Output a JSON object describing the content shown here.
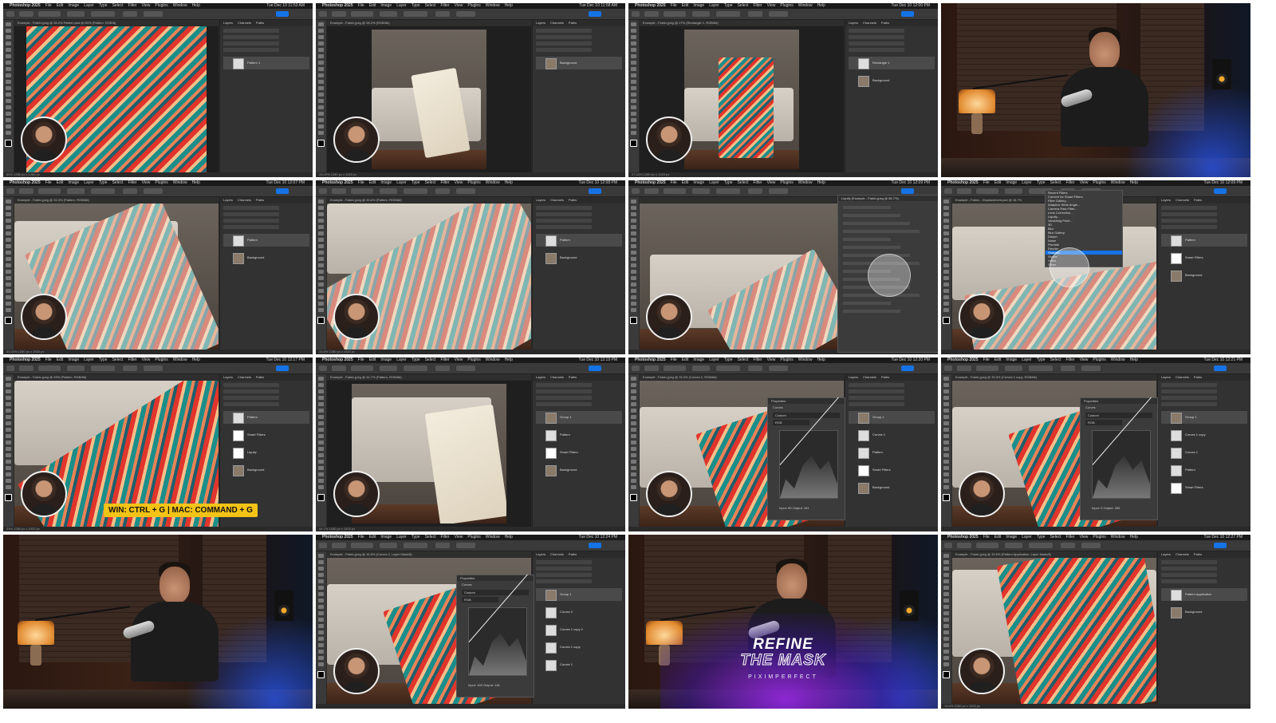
{
  "menubar": {
    "app": "Photoshop 2025",
    "items": [
      "File",
      "Edit",
      "Image",
      "Layer",
      "Type",
      "Select",
      "Filter",
      "View",
      "Plugins",
      "Window",
      "Help"
    ],
    "title": "Adobe Photoshop 2025"
  },
  "panel_tabs": [
    "Layers",
    "Channels",
    "Paths"
  ],
  "tiles": [
    {
      "kind": "ps",
      "clock": "Tue Dec 10 11:53 AM",
      "tab": "Example - Fabric.jpeg @ 28.2%   Pattern.psd @ 50% (Pattern, RGB/8)",
      "layers": [
        "Pattern 1"
      ],
      "status": "50%   1280 px x 1280 px"
    },
    {
      "kind": "ps",
      "clock": "Tue Dec 10 11:58 AM",
      "tab": "Example - Fabric.jpeg @ 28.2% (RGB/8#)",
      "layers": [
        "Background"
      ],
      "status": "28.09%   1280 px x 1920 px"
    },
    {
      "kind": "ps",
      "clock": "Tue Dec 10 12:00 PM",
      "tab": "Example - Fabric.jpeg @ 27% (Rectangle 1, RGB/8#)",
      "layers": [
        "Rectangle 1",
        "Background"
      ],
      "status": "27.04%   1280 px x 1920 px"
    },
    {
      "kind": "studio"
    },
    {
      "kind": "ps",
      "clock": "Tue Dec 10 12:07 PM",
      "tab": "Example - Fabric.jpeg @ 33.3% (Pattern, RGB/8#)",
      "layers": [
        "Pattern",
        "Background"
      ],
      "status": "33.33%   1280 px x 1920 px"
    },
    {
      "kind": "ps",
      "clock": "Tue Dec 10 12:08 PM",
      "tab": "Example - Fabric.jpeg @ 33.6% (Pattern, RGB/8#)",
      "layers": [
        "Pattern",
        "Background"
      ],
      "status": "33.6%   1280 px x 1920 px"
    },
    {
      "kind": "ps-dialog",
      "dialog_title": "Liquify (Example - Fabric.jpeg @ 66.7%)",
      "clock": "Tue Dec 10 12:09 PM"
    },
    {
      "kind": "ps-menu",
      "clock": "Tue Dec 10 12:09 PM",
      "tab": "Example - Fabric - Displacement.psd @ 16.7%",
      "menu": [
        "Recent Filters",
        "Convert for Smart Filters",
        "Filter Gallery...",
        "Adaptive Wide Angle...",
        "Camera Raw Filter...",
        "Lens Correction...",
        "Liquify...",
        "Vanishing Point...",
        "3D",
        "Blur",
        "Blur Gallery",
        "Distort",
        "Noise",
        "Pixelate",
        "Render",
        "Sharpen",
        "Stylize",
        "Video",
        "Other"
      ],
      "menu_highlight": "Sharpen",
      "layers": [
        "Pattern",
        "Smart Filters",
        "Background"
      ]
    },
    {
      "kind": "ps",
      "clock": "Tue Dec 10 12:17 PM",
      "tab": "Example - Fabric.jpeg @ 33% (Pattern, RGB/8#)",
      "layers": [
        "Pattern",
        "Smart Filters",
        "Liquify",
        "Background"
      ],
      "status": "33%   1280 px x 1920 px",
      "shortcut": "WIN: CTRL + G | MAC: COMMAND + G"
    },
    {
      "kind": "ps",
      "clock": "Tue Dec 10 12:19 PM",
      "tab": "Example - Fabric.jpeg @ 44.7% (Pattern, RGB/8#)",
      "layers": [
        "Group 1",
        "Pattern",
        "Smart Filters",
        "Background"
      ],
      "status": "44.7%   1280 px x 1920 px"
    },
    {
      "kind": "ps-curves",
      "clock": "Tue Dec 10 12:20 PM",
      "tab": "Example - Fabric.jpeg @ 33.3% (Curves 1, RGB/8#)",
      "layers": [
        "Group 1",
        "Curves 1",
        "Pattern",
        "Smart Filters",
        "Background"
      ],
      "props": "Properties",
      "curves": "Curves",
      "preset": "Custom",
      "channel": "RGB",
      "input": "Input: 89",
      "output": "Output: 161"
    },
    {
      "kind": "ps-curves",
      "clock": "Tue Dec 10 12:21 PM",
      "tab": "Example - Fabric.jpeg @ 33.3% (Curves 1 copy, RGB/8#)",
      "layers": [
        "Group 1",
        "Curves 1 copy",
        "Curves 1",
        "Pattern",
        "Smart Filters"
      ],
      "props": "Properties",
      "curves": "Curves",
      "preset": "Custom",
      "channel": "RGB",
      "input": "Input: 0",
      "output": "Output: 255"
    },
    {
      "kind": "studio2"
    },
    {
      "kind": "ps-curves",
      "clock": "Tue Dec 10 12:24 PM",
      "tab": "Example - Fabric.jpeg @ 16.6% (Curves 2, Layer Mask/8)",
      "layers": [
        "Group 1",
        "Curves 2",
        "Curves 1 copy 2",
        "Curves 1 copy",
        "Curves 1"
      ],
      "props": "Properties",
      "curves": "Curves",
      "preset": "Custom",
      "channel": "RGB",
      "input": "Input: 169",
      "output": "Output: 118"
    },
    {
      "kind": "studio-refine",
      "line1": "REFINE",
      "line2": "THE MASK",
      "line3": "PIXIMPERFECT"
    },
    {
      "kind": "ps",
      "clock": "Tue Dec 10 12:27 PM",
      "tab": "Example - Fabric.jpeg @ 19.6% (Pattern Application, Layer Mask/8)",
      "layers": [
        "Pattern Application",
        "Background"
      ],
      "status": "19.6%   1280 px x 1920 px"
    }
  ]
}
